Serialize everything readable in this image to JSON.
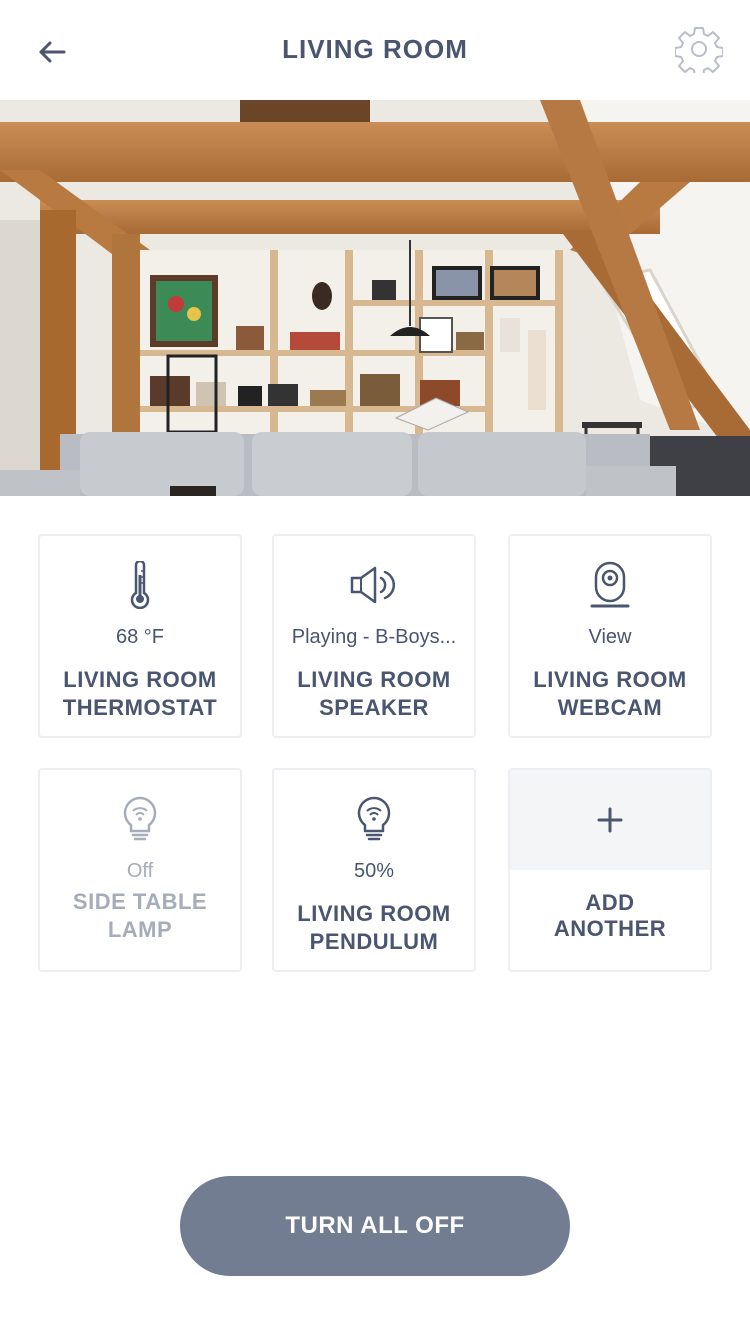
{
  "header": {
    "title": "LIVING ROOM",
    "back_icon": "arrow-left-icon",
    "settings_icon": "gear-icon"
  },
  "hero": {
    "image": "living-room-photo"
  },
  "devices": [
    {
      "icon": "thermometer-icon",
      "status": "68 °F",
      "name_line1": "LIVING ROOM",
      "name_line2": "THERMOSTAT",
      "state": "on"
    },
    {
      "icon": "speaker-icon",
      "status": "Playing - B-Boys...",
      "name_line1": "LIVING ROOM",
      "name_line2": "SPEAKER",
      "state": "on"
    },
    {
      "icon": "webcam-icon",
      "status": "View",
      "name_line1": "LIVING ROOM",
      "name_line2": "WEBCAM",
      "state": "on"
    },
    {
      "icon": "bulb-icon",
      "status": "Off",
      "name_line1": "SIDE TABLE",
      "name_line2": "LAMP",
      "state": "off"
    },
    {
      "icon": "bulb-icon",
      "status": "50%",
      "name_line1": "LIVING ROOM",
      "name_line2": "PENDULUM",
      "state": "on"
    }
  ],
  "add_tile": {
    "icon": "plus-icon",
    "label_line1": "ADD",
    "label_line2": "ANOTHER"
  },
  "footer": {
    "turn_all_off_label": "TURN ALL OFF"
  },
  "colors": {
    "text": "#4a5570",
    "muted": "#a6acb9",
    "button": "#737d92",
    "tile_border": "#eceef1",
    "add_top": "#f4f5f7"
  }
}
